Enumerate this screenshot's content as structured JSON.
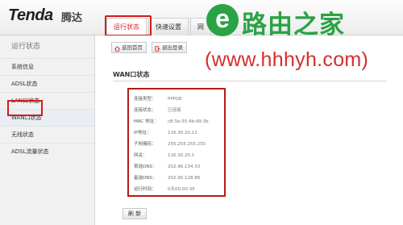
{
  "header": {
    "logo": "Tenda",
    "logo_cn": "腾达",
    "tabs": [
      {
        "label": "运行状态"
      },
      {
        "label": "快速设置"
      },
      {
        "label": "网"
      }
    ]
  },
  "sidebar": {
    "title": "运行状态",
    "items": [
      {
        "label": "系统信息"
      },
      {
        "label": "ADSL状态"
      },
      {
        "label": "LAN口状态"
      },
      {
        "label": "WAN口状态"
      },
      {
        "label": "无线状态"
      },
      {
        "label": "ADSL流量状态"
      }
    ]
  },
  "toolbar": {
    "home_label": "返回首页",
    "logout_label": "退出登录"
  },
  "main": {
    "section_title": "WAN口状态",
    "rows": [
      {
        "label": "连接类型：",
        "value": "PPPOE"
      },
      {
        "label": "连接状态：",
        "value": "已连接"
      },
      {
        "label": "MAC 地址：",
        "value": "c8:3a:35:4b:49:3b"
      },
      {
        "label": "IP地址：",
        "value": "116.30.20.11"
      },
      {
        "label": "子网掩码：",
        "value": "255.255.255.255"
      },
      {
        "label": "网关：",
        "value": "116.30.20.1"
      },
      {
        "label": "首选DNS：",
        "value": "202.96.134.33"
      },
      {
        "label": "备选DNS：",
        "value": "202.96.128.86"
      },
      {
        "label": "运行时间：",
        "value": "0天00:00:35"
      }
    ],
    "refresh_label": "刷 新"
  },
  "watermark": {
    "logo_letter": "e",
    "name": "路由之家",
    "url": "(www.hhhyh.com)"
  },
  "colors": {
    "highlight": "#d11c1c",
    "watermark_green": "#2aa345",
    "watermark_red": "#d62d2d"
  }
}
